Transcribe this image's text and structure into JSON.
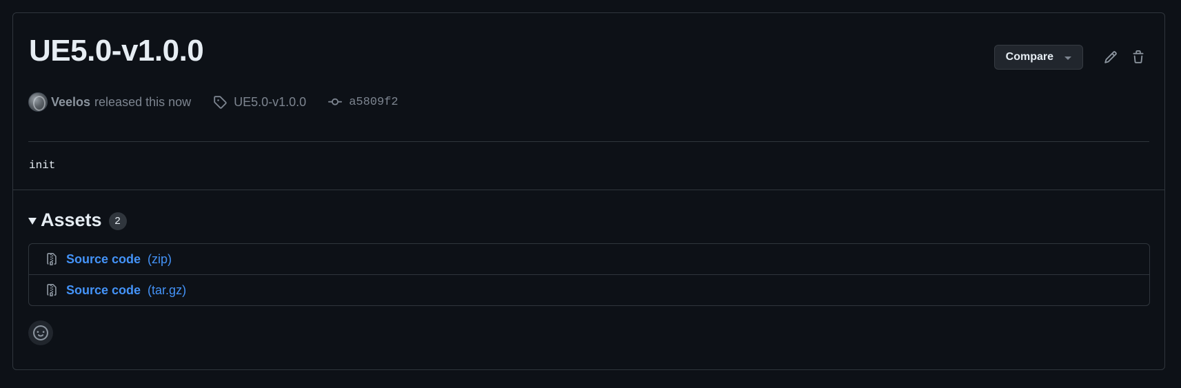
{
  "release": {
    "title": "UE5.0-v1.0.0",
    "author": "Veelos",
    "released_text": "released this now",
    "tag": "UE5.0-v1.0.0",
    "commit": "a5809f2",
    "body": "init"
  },
  "actions": {
    "compare_label": "Compare",
    "edit_icon": "pencil-icon",
    "delete_icon": "trash-icon"
  },
  "assets": {
    "title": "Assets",
    "count": "2",
    "items": [
      {
        "name": "Source code",
        "ext": "(zip)",
        "icon": "file-zip-icon"
      },
      {
        "name": "Source code",
        "ext": "(tar.gz)",
        "icon": "file-zip-icon"
      }
    ]
  },
  "reactions": {
    "icon": "smiley-icon"
  },
  "colors": {
    "background": "#0d1117",
    "border": "#30363d",
    "link": "#4493f8",
    "muted": "#7d8590",
    "text": "#e6edf3"
  }
}
